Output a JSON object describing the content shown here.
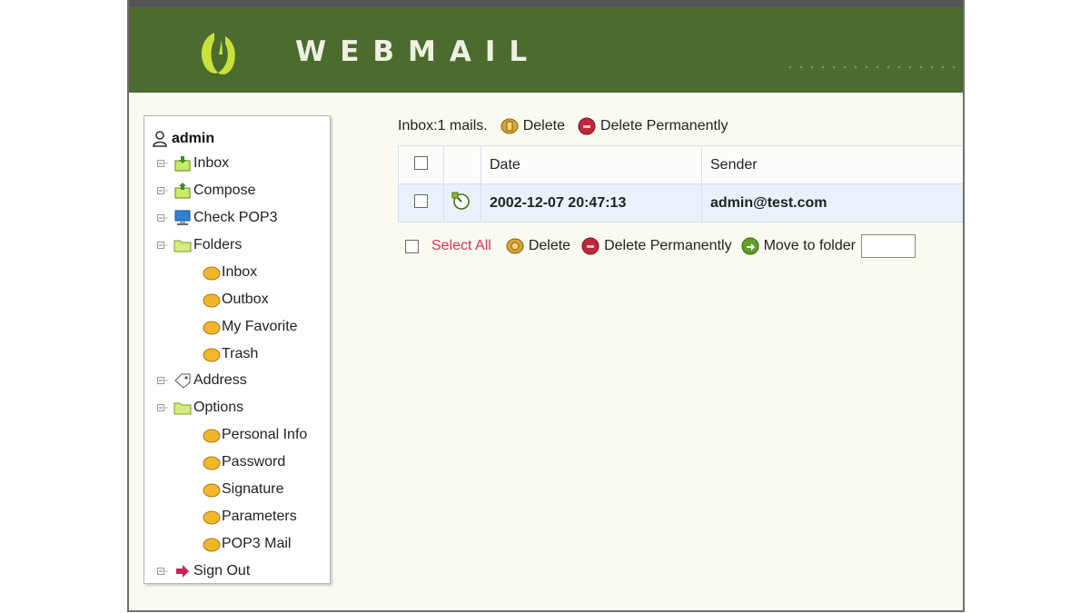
{
  "header": {
    "brand": "WEBMAIL",
    "logo": "webmail-logo-icon"
  },
  "sidebar": {
    "user": "admin",
    "items": [
      {
        "label": "Inbox",
        "icon": "inbox-icon"
      },
      {
        "label": "Compose",
        "icon": "compose-icon"
      },
      {
        "label": "Check POP3",
        "icon": "monitor-icon"
      },
      {
        "label": "Folders",
        "icon": "folder-icon"
      },
      {
        "label": "Inbox",
        "icon": "folder-item-icon"
      },
      {
        "label": "Outbox",
        "icon": "folder-item-icon"
      },
      {
        "label": "My Favorite",
        "icon": "folder-item-icon"
      },
      {
        "label": "Trash",
        "icon": "folder-item-icon"
      },
      {
        "label": "Address",
        "icon": "address-icon"
      },
      {
        "label": "Options",
        "icon": "folder-icon"
      },
      {
        "label": "Personal Info",
        "icon": "option-item-icon"
      },
      {
        "label": "Password",
        "icon": "option-item-icon"
      },
      {
        "label": "Signature",
        "icon": "option-item-icon"
      },
      {
        "label": "Parameters",
        "icon": "option-item-icon"
      },
      {
        "label": "POP3 Mail",
        "icon": "option-item-icon"
      },
      {
        "label": "Sign Out",
        "icon": "sign-out-arrow-icon"
      }
    ]
  },
  "main": {
    "summary": "Inbox:1 mails.",
    "delete_label": "Delete",
    "delete_perm_label": "Delete Permanently",
    "columns": [
      "Date",
      "Sender"
    ],
    "rows": [
      {
        "date": "2002-12-07 20:47:13",
        "sender": "admin@test.com"
      }
    ],
    "select_all": "Select All",
    "move_label": "Move to folder"
  },
  "colors": {
    "header": "#4c6b2f",
    "accent": "#e0305e",
    "background": "#fbfaf0"
  }
}
